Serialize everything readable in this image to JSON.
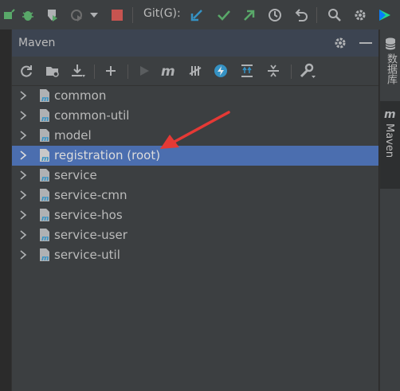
{
  "toolbar": {
    "git_label": "Git(G):",
    "icons": [
      "build-icon",
      "debug-icon",
      "coverage-icon",
      "profile-icon",
      "dropdown-icon",
      "stop-icon",
      "update-project-icon",
      "commit-icon",
      "push-icon",
      "history-icon",
      "rollback-icon",
      "search-icon",
      "settings-icon",
      "plugin-icon"
    ]
  },
  "panel": {
    "title": "Maven",
    "toolbar_icons": [
      "reload-icon",
      "generate-sources-icon",
      "download-icon",
      "add-icon",
      "run-icon",
      "execute-goal-icon",
      "toggle-offline-icon",
      "skip-tests-icon",
      "show-dependencies-icon",
      "collapse-all-icon",
      "settings-icon"
    ]
  },
  "tree": {
    "items": [
      {
        "label": "common"
      },
      {
        "label": "common-util"
      },
      {
        "label": "model"
      },
      {
        "label": "registration (root)",
        "selected": true
      },
      {
        "label": "service"
      },
      {
        "label": "service-cmn"
      },
      {
        "label": "service-hos"
      },
      {
        "label": "service-user"
      },
      {
        "label": "service-util"
      }
    ]
  },
  "right_strip": {
    "database_tab": "数据库",
    "maven_tab": "Maven"
  },
  "colors": {
    "accent_selected": "#4b6eaf",
    "annotation_arrow": "#e53935"
  }
}
